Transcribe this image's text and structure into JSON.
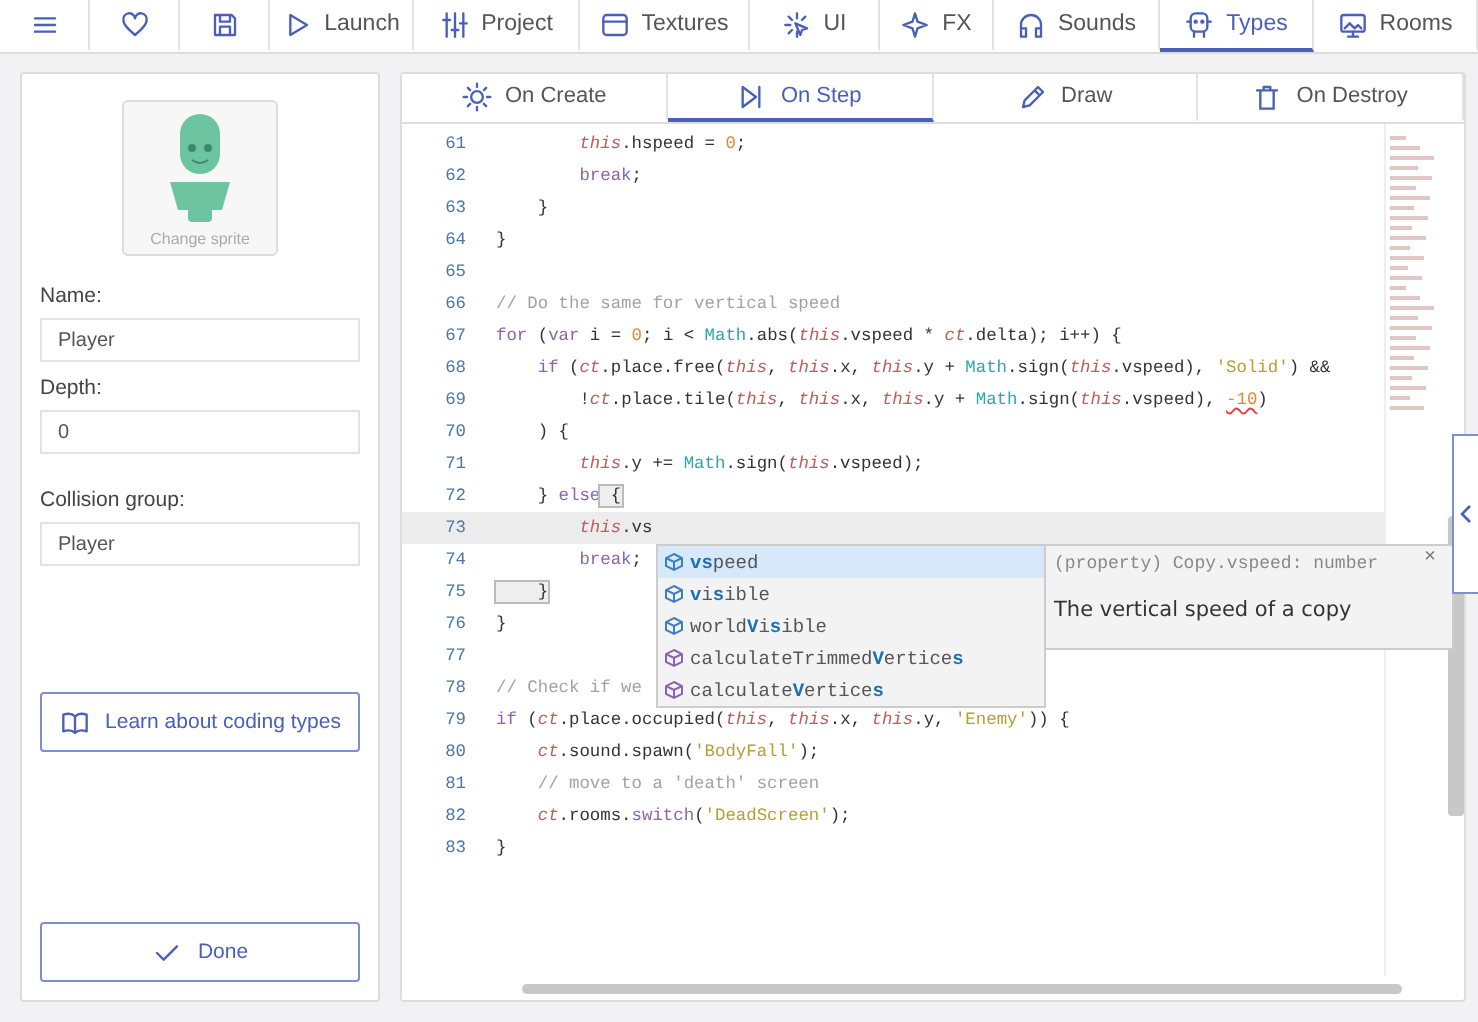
{
  "nav": [
    {
      "kind": "menu",
      "selected": false
    },
    {
      "kind": "heart",
      "selected": false
    },
    {
      "kind": "save",
      "selected": false
    },
    {
      "kind": "play",
      "label": "Launch",
      "selected": false
    },
    {
      "kind": "sliders",
      "label": "Project",
      "selected": false
    },
    {
      "kind": "window",
      "label": "Textures",
      "selected": false
    },
    {
      "kind": "cursor",
      "label": "UI",
      "selected": false
    },
    {
      "kind": "sparkle",
      "label": "FX",
      "selected": false
    },
    {
      "kind": "headphones",
      "label": "Sounds",
      "selected": false
    },
    {
      "kind": "types",
      "label": "Types",
      "selected": true
    },
    {
      "kind": "image",
      "label": "Rooms",
      "selected": false
    }
  ],
  "sidebar": {
    "sprite_label": "Change sprite",
    "fields": [
      {
        "label": "Name:",
        "value": "Player"
      },
      {
        "label": "Depth:",
        "value": "0"
      },
      {
        "label": "Collision group:",
        "value": "Player"
      }
    ],
    "learn_button": "Learn about coding types",
    "done_button": "Done"
  },
  "event_tabs": [
    {
      "kind": "sun",
      "label": "On Create",
      "selected": false
    },
    {
      "kind": "step",
      "label": "On Step",
      "selected": true
    },
    {
      "kind": "pencil",
      "label": "Draw",
      "selected": false
    },
    {
      "kind": "trash",
      "label": "On Destroy",
      "selected": false
    }
  ],
  "editor": {
    "lines": [
      {
        "number": "61",
        "current": false,
        "tokens": [
          {
            "kind": "this",
            "text": "        this"
          },
          {
            "kind": "plain",
            "text": ".hspeed = "
          },
          {
            "kind": "num",
            "text": "0"
          },
          {
            "kind": "plain",
            "text": ";"
          }
        ]
      },
      {
        "number": "62",
        "current": false,
        "tokens": [
          {
            "kind": "kw",
            "text": "        break"
          },
          {
            "kind": "plain",
            "text": ";"
          }
        ]
      },
      {
        "number": "63",
        "current": false,
        "tokens": [
          {
            "kind": "plain",
            "text": "    }"
          }
        ]
      },
      {
        "number": "64",
        "current": false,
        "tokens": [
          {
            "kind": "plain",
            "text": "}"
          }
        ]
      },
      {
        "number": "65",
        "current": false
      },
      {
        "number": "66",
        "current": false,
        "tokens": [
          {
            "kind": "comment",
            "text": "// Do the same for vertical speed"
          }
        ]
      },
      {
        "number": "67",
        "current": false,
        "tokens": [
          {
            "kind": "kw",
            "text": "for"
          },
          {
            "kind": "plain",
            "text": " ("
          },
          {
            "kind": "kw",
            "text": "var"
          },
          {
            "kind": "plain",
            "text": " i = "
          },
          {
            "kind": "num",
            "text": "0"
          },
          {
            "kind": "plain",
            "text": "; i < "
          },
          {
            "kind": "builtin",
            "text": "Math"
          },
          {
            "kind": "plain",
            "text": ".abs("
          },
          {
            "kind": "this",
            "text": "this"
          },
          {
            "kind": "plain",
            "text": ".vspeed * "
          },
          {
            "kind": "this",
            "text": "ct"
          },
          {
            "kind": "plain",
            "text": ".delta); i++) {"
          }
        ]
      },
      {
        "number": "68",
        "current": false,
        "tokens": [
          {
            "kind": "kw",
            "text": "    if"
          },
          {
            "kind": "plain",
            "text": " ("
          },
          {
            "kind": "this",
            "text": "ct"
          },
          {
            "kind": "plain",
            "text": ".place.free("
          },
          {
            "kind": "this",
            "text": "this"
          },
          {
            "kind": "plain",
            "text": ", "
          },
          {
            "kind": "this",
            "text": "this"
          },
          {
            "kind": "plain",
            "text": ".x, "
          },
          {
            "kind": "this",
            "text": "this"
          },
          {
            "kind": "plain",
            "text": ".y + "
          },
          {
            "kind": "builtin",
            "text": "Math"
          },
          {
            "kind": "plain",
            "text": ".sign("
          },
          {
            "kind": "this",
            "text": "this"
          },
          {
            "kind": "plain",
            "text": ".vspeed), "
          },
          {
            "kind": "string",
            "text": "'Solid'"
          },
          {
            "kind": "plain",
            "text": ") &&"
          }
        ]
      },
      {
        "number": "69",
        "current": false,
        "tokens": [
          {
            "kind": "plain",
            "text": "        !"
          },
          {
            "kind": "this",
            "text": "ct"
          },
          {
            "kind": "plain",
            "text": ".place.tile("
          },
          {
            "kind": "this",
            "text": "this"
          },
          {
            "kind": "plain",
            "text": ", "
          },
          {
            "kind": "this",
            "text": "this"
          },
          {
            "kind": "plain",
            "text": ".x, "
          },
          {
            "kind": "this",
            "text": "this"
          },
          {
            "kind": "plain",
            "text": ".y + "
          },
          {
            "kind": "builtin",
            "text": "Math"
          },
          {
            "kind": "plain",
            "text": ".sign("
          },
          {
            "kind": "this",
            "text": "this"
          },
          {
            "kind": "plain",
            "text": ".vspeed), "
          },
          {
            "kind": "error",
            "text": "-10"
          },
          {
            "kind": "plain",
            "text": ")"
          }
        ]
      },
      {
        "number": "70",
        "current": false,
        "tokens": [
          {
            "kind": "plain",
            "text": "    ) {"
          }
        ]
      },
      {
        "number": "71",
        "current": false,
        "tokens": [
          {
            "kind": "this",
            "text": "        this"
          },
          {
            "kind": "plain",
            "text": ".y += "
          },
          {
            "kind": "builtin",
            "text": "Math"
          },
          {
            "kind": "plain",
            "text": ".sign("
          },
          {
            "kind": "this",
            "text": "this"
          },
          {
            "kind": "plain",
            "text": ".vspeed);"
          }
        ]
      },
      {
        "number": "72",
        "current": false,
        "tokens": [
          {
            "kind": "plain",
            "text": "    } "
          },
          {
            "kind": "kw",
            "text": "else"
          },
          {
            "kind": "match",
            "text": " {"
          }
        ]
      },
      {
        "number": "73",
        "current": true,
        "tokens": [
          {
            "kind": "this",
            "text": "        this"
          },
          {
            "kind": "plain",
            "text": ".vs"
          }
        ]
      },
      {
        "number": "74",
        "current": false,
        "tokens": [
          {
            "kind": "kw",
            "text": "        break"
          },
          {
            "kind": "plain",
            "text": ";"
          }
        ]
      },
      {
        "number": "75",
        "current": false,
        "tokens": [
          {
            "kind": "match",
            "text": "    }"
          }
        ]
      },
      {
        "number": "76",
        "current": false,
        "tokens": [
          {
            "kind": "plain",
            "text": "}"
          }
        ]
      },
      {
        "number": "77",
        "current": false
      },
      {
        "number": "78",
        "current": false,
        "tokens": [
          {
            "kind": "comment",
            "text": "// Check if we"
          }
        ]
      },
      {
        "number": "79",
        "current": false,
        "tokens": [
          {
            "kind": "kw",
            "text": "if"
          },
          {
            "kind": "plain",
            "text": " ("
          },
          {
            "kind": "this",
            "text": "ct"
          },
          {
            "kind": "plain",
            "text": ".place.occupied("
          },
          {
            "kind": "this",
            "text": "this"
          },
          {
            "kind": "plain",
            "text": ", "
          },
          {
            "kind": "this",
            "text": "this"
          },
          {
            "kind": "plain",
            "text": ".x, "
          },
          {
            "kind": "this",
            "text": "this"
          },
          {
            "kind": "plain",
            "text": ".y, "
          },
          {
            "kind": "string",
            "text": "'Enemy'"
          },
          {
            "kind": "plain",
            "text": ")) {"
          }
        ]
      },
      {
        "number": "80",
        "current": false,
        "tokens": [
          {
            "kind": "this",
            "text": "    ct"
          },
          {
            "kind": "plain",
            "text": ".sound.spawn("
          },
          {
            "kind": "string",
            "text": "'BodyFall'"
          },
          {
            "kind": "plain",
            "text": ");"
          }
        ]
      },
      {
        "number": "81",
        "current": false,
        "tokens": [
          {
            "kind": "comment",
            "text": "    // move to a 'death' screen"
          }
        ]
      },
      {
        "number": "82",
        "current": false,
        "tokens": [
          {
            "kind": "this",
            "text": "    ct"
          },
          {
            "kind": "plain",
            "text": ".rooms."
          },
          {
            "kind": "kw",
            "text": "switch"
          },
          {
            "kind": "plain",
            "text": "("
          },
          {
            "kind": "string",
            "text": "'DeadScreen'"
          },
          {
            "kind": "plain",
            "text": ");"
          }
        ]
      },
      {
        "number": "83",
        "current": false,
        "tokens": [
          {
            "kind": "plain",
            "text": "}"
          }
        ]
      }
    ],
    "autocomplete": {
      "items": [
        {
          "kind": "property",
          "text": "**vs**peed",
          "selected": true
        },
        {
          "kind": "property",
          "text": "**v**i**s**ible",
          "selected": false
        },
        {
          "kind": "property",
          "text": "world**V**i**s**ible",
          "selected": false
        },
        {
          "kind": "method",
          "text": "calculateTrimmed**V**ertice**s**",
          "selected": false
        },
        {
          "kind": "method",
          "text": "calculate**V**ertice**s**",
          "selected": false
        }
      ],
      "detail": {
        "signature": "(property) Copy.vspeed: number",
        "description": "The vertical speed of a copy",
        "close": "×"
      }
    }
  }
}
